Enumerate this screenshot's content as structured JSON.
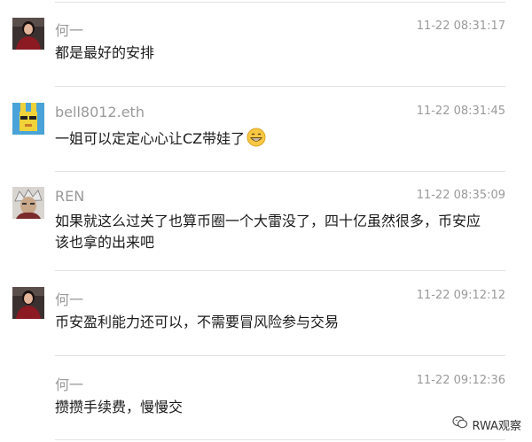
{
  "comments": [
    {
      "name": "何一",
      "time": "11-22 08:31:17",
      "text": "都是最好的安排",
      "avatar": "woman-red-dress-avatar"
    },
    {
      "name": "bell8012.eth",
      "time": "11-22 08:31:45",
      "text": "一姐可以定定心心让CZ带娃了",
      "emoji": "grinning-face-emoji",
      "avatar": "yellow-rabbit-sunglasses-avatar"
    },
    {
      "name": "REN",
      "time": "11-22 08:35:09",
      "text": "如果就这么过关了也算币圈一个大雷没了，四十亿虽然很多，币安应该也拿的出来吧",
      "avatar": "anime-character-avatar"
    },
    {
      "name": "何一",
      "time": "11-22 09:12:12",
      "text": "币安盈利能力还可以，不需要冒风险参与交易",
      "avatar": "woman-red-dress-avatar"
    },
    {
      "name": "何一",
      "time": "11-22 09:12:36",
      "text": "攒攒手续费，慢慢交"
    }
  ],
  "watermark": {
    "icon": "wechat-icon",
    "text": "RWA观察"
  }
}
